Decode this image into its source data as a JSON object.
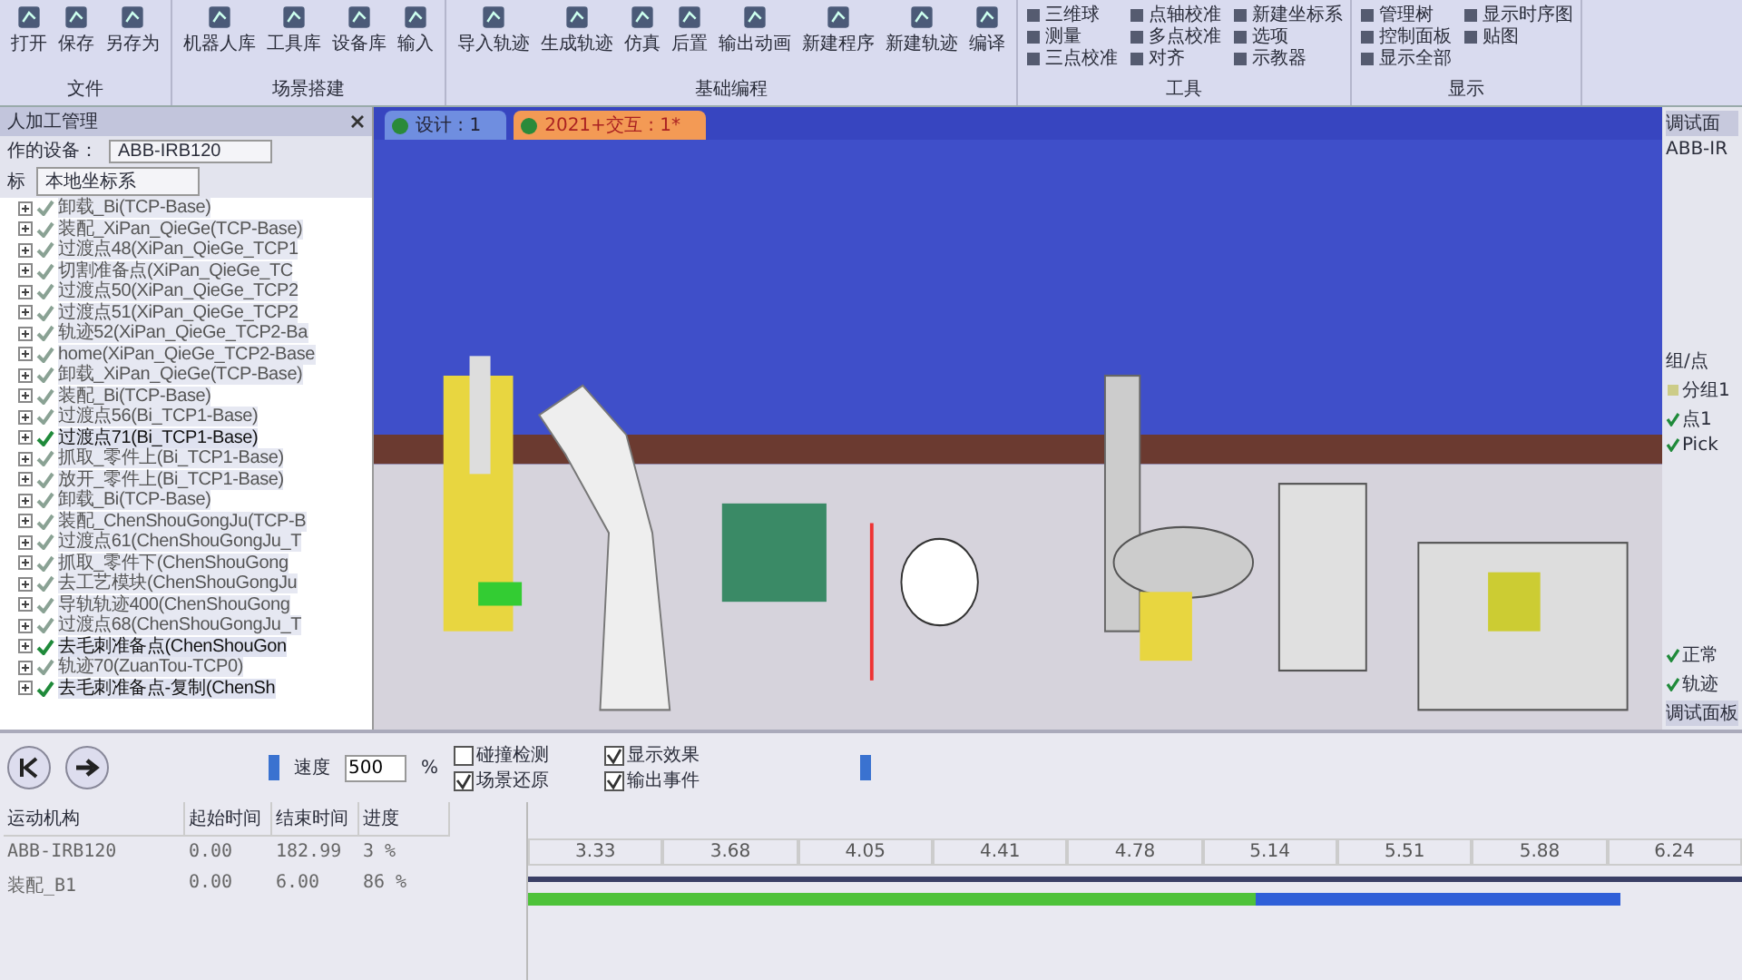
{
  "ribbon": {
    "groups": [
      {
        "label": "文件",
        "kind": "large",
        "buttons": [
          "打开",
          "保存",
          "另存为"
        ]
      },
      {
        "label": "场景搭建",
        "kind": "large",
        "buttons": [
          "机器人库",
          "工具库",
          "设备库",
          "输入"
        ]
      },
      {
        "label": "基础编程",
        "kind": "large",
        "buttons": [
          "导入轨迹",
          "生成轨迹",
          "仿真",
          "后置",
          "输出动画",
          "新建程序",
          "新建轨迹",
          "编译"
        ]
      },
      {
        "label": "工具",
        "kind": "small",
        "buttons": [
          "三维球",
          "测量",
          "三点校准",
          "点轴校准",
          "多点校准",
          "对齐",
          "新建坐标系",
          "选项",
          "示教器"
        ]
      },
      {
        "label": "显示",
        "kind": "small",
        "buttons": [
          "管理树",
          "控制面板",
          "显示全部",
          "显示时序图",
          "贴图"
        ]
      }
    ]
  },
  "left_panel": {
    "title": "人加工管理",
    "device_label": "作的设备：",
    "device_value": "ABB-IRB120",
    "coord_label": "标",
    "coord_value": "本地坐标系",
    "tree": [
      {
        "label": "卸载_Bi(TCP-Base)",
        "checked": true,
        "active": false
      },
      {
        "label": "装配_XiPan_QieGe(TCP-Base)",
        "checked": true,
        "active": false
      },
      {
        "label": "过渡点48(XiPan_QieGe_TCP1",
        "checked": true,
        "active": false
      },
      {
        "label": "切割准备点(XiPan_QieGe_TC",
        "checked": true,
        "active": false
      },
      {
        "label": "过渡点50(XiPan_QieGe_TCP2",
        "checked": true,
        "active": false
      },
      {
        "label": "过渡点51(XiPan_QieGe_TCP2",
        "checked": true,
        "active": false
      },
      {
        "label": "轨迹52(XiPan_QieGe_TCP2-Ba",
        "checked": true,
        "active": false
      },
      {
        "label": "home(XiPan_QieGe_TCP2-Base",
        "checked": true,
        "active": false
      },
      {
        "label": "卸载_XiPan_QieGe(TCP-Base)",
        "checked": true,
        "active": false
      },
      {
        "label": "装配_Bi(TCP-Base)",
        "checked": true,
        "active": false
      },
      {
        "label": "过渡点56(Bi_TCP1-Base)",
        "checked": true,
        "active": false
      },
      {
        "label": "过渡点71(Bi_TCP1-Base)",
        "checked": true,
        "active": true
      },
      {
        "label": "抓取_零件上(Bi_TCP1-Base)",
        "checked": true,
        "active": false
      },
      {
        "label": "放开_零件上(Bi_TCP1-Base)",
        "checked": true,
        "active": false
      },
      {
        "label": "卸载_Bi(TCP-Base)",
        "checked": true,
        "active": false
      },
      {
        "label": "装配_ChenShouGongJu(TCP-B",
        "checked": true,
        "active": false
      },
      {
        "label": "过渡点61(ChenShouGongJu_T",
        "checked": true,
        "active": false
      },
      {
        "label": "抓取_零件下(ChenShouGong",
        "checked": true,
        "active": false
      },
      {
        "label": "去工艺模块(ChenShouGongJu",
        "checked": true,
        "active": false
      },
      {
        "label": "导轨轨迹400(ChenShouGong",
        "checked": true,
        "active": false
      },
      {
        "label": "过渡点68(ChenShouGongJu_T",
        "checked": true,
        "active": false
      },
      {
        "label": "去毛刺准备点(ChenShouGon",
        "checked": true,
        "active": true
      },
      {
        "label": "轨迹70(ZuanTou-TCP0)",
        "checked": true,
        "active": false
      },
      {
        "label": "去毛刺准备点-复制(ChenSh",
        "checked": true,
        "active": true
      }
    ]
  },
  "tabs": [
    {
      "label": "设计 : 1",
      "selected": false
    },
    {
      "label": "2021+交互 : 1*",
      "selected": true
    }
  ],
  "right_panel": {
    "title": "调试面",
    "device": "ABB-IR",
    "group_header": "组/点",
    "items": [
      {
        "label": "分组1",
        "checked": false
      },
      {
        "label": "点1",
        "checked": true
      },
      {
        "label": "Pick",
        "checked": true
      }
    ],
    "status": [
      {
        "label": "正常",
        "checked": true
      },
      {
        "label": "轨迹",
        "checked": true
      }
    ],
    "bottom_tab": "调试面板"
  },
  "sim": {
    "speed_label": "速度",
    "speed_value": "500",
    "percent": "%",
    "options": [
      {
        "label": "碰撞检测",
        "checked": false
      },
      {
        "label": "场景还原",
        "checked": true
      },
      {
        "label": "显示效果",
        "checked": true
      },
      {
        "label": "输出事件",
        "checked": true
      }
    ],
    "columns": [
      "运动机构",
      "起始时间",
      "结束时间",
      "进度"
    ],
    "rows": [
      {
        "cells": [
          "ABB-IRB120",
          "0.00",
          "182.99",
          "3 %"
        ]
      },
      {
        "cells": [
          "装配_B1",
          "0.00",
          "6.00",
          "86 %"
        ]
      }
    ],
    "ticks": [
      "3.33",
      "3.68",
      "4.05",
      "4.41",
      "4.78",
      "5.14",
      "5.51",
      "5.88",
      "6.24"
    ]
  }
}
